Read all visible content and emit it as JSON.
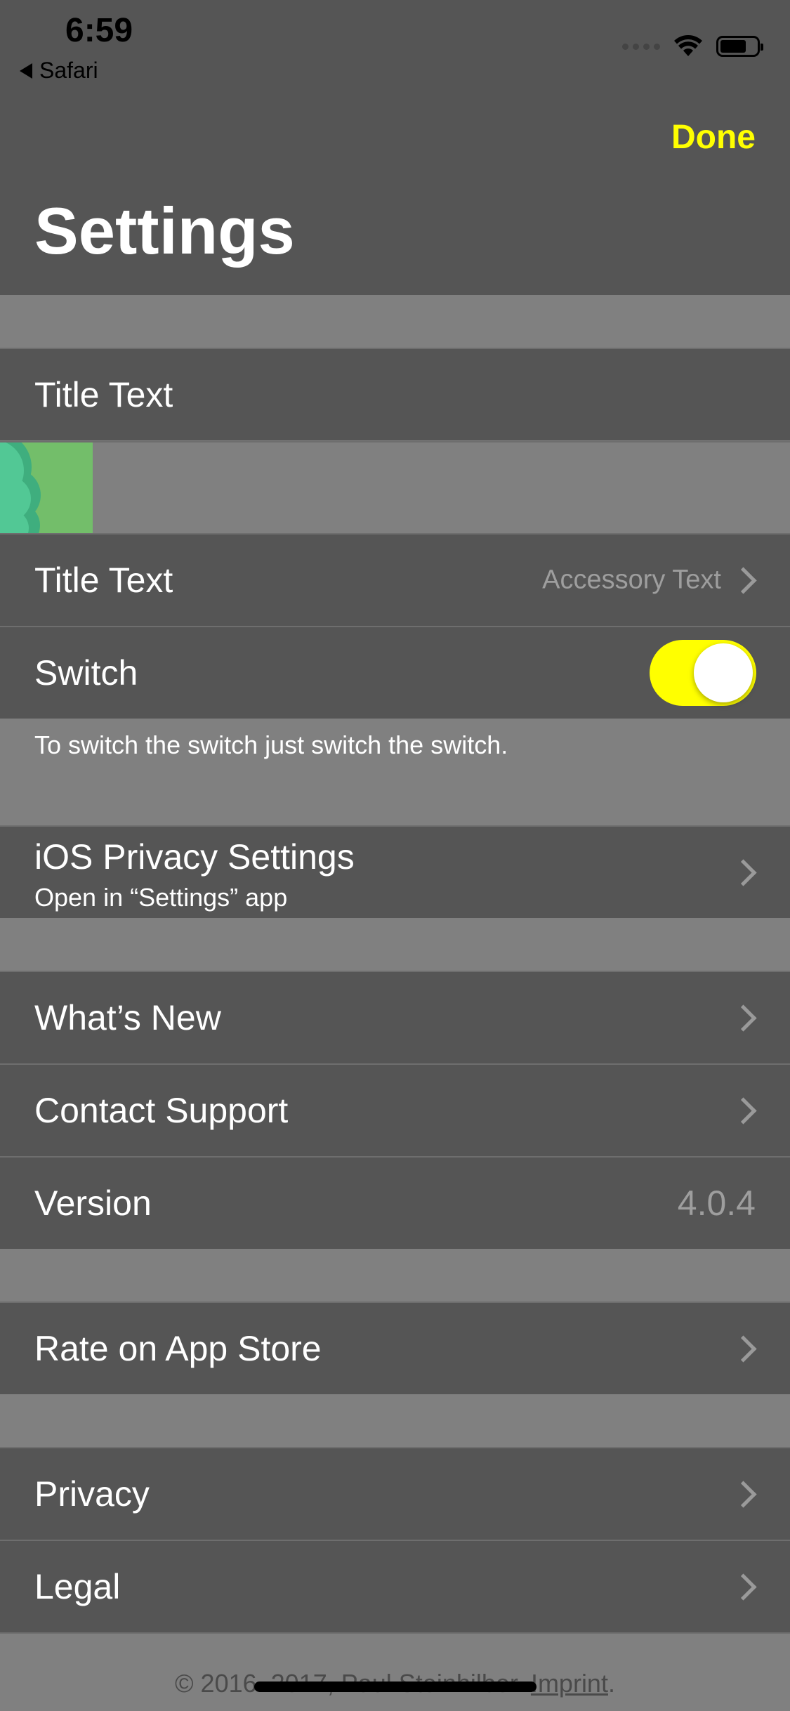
{
  "status_bar": {
    "time": "6:59",
    "back_app": "Safari"
  },
  "nav": {
    "done_label": "Done",
    "title": "Settings"
  },
  "rows": {
    "title_text_1": "Title Text",
    "title_text_2": "Title Text",
    "accessory_text": "Accessory Text",
    "switch_label": "Switch",
    "switch_on": true,
    "switch_footer": "To switch the switch just switch the switch.",
    "ios_privacy_title": "iOS Privacy Settings",
    "ios_privacy_subtitle": "Open in “Settings” app",
    "whats_new": "What’s New",
    "contact_support": "Contact Support",
    "version_label": "Version",
    "version_value": "4.0.4",
    "rate": "Rate on App Store",
    "privacy": "Privacy",
    "legal": "Legal"
  },
  "footer": {
    "copyright": "© 2016–2017, Paul Steinhilber.",
    "imprint": "Imprint",
    "period": "."
  },
  "colors": {
    "accent": "#ffff00",
    "cell_background": "#555555",
    "group_background": "#808080",
    "secondary_text": "#9e9e9e"
  },
  "icons": [
    "back-arrow-icon",
    "wifi-icon",
    "battery-icon",
    "signal-dots-icon",
    "chevron-right-icon",
    "cloud-thumbnail-icon"
  ]
}
